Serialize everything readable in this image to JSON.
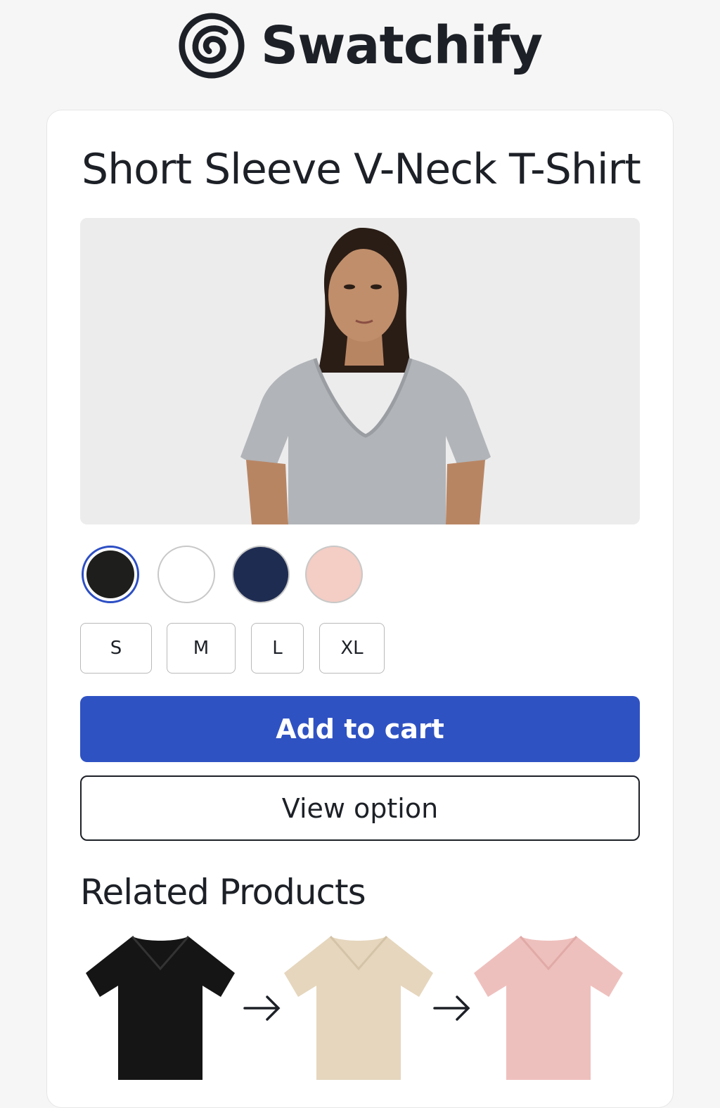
{
  "brand": {
    "name": "Swatchify",
    "logo_icon": "swirl-logo-icon"
  },
  "product": {
    "title": "Short Sleeve V-Neck T-Shirt",
    "image": "model-in-gray-vneck-tshirt",
    "colors": [
      {
        "name": "black",
        "hex": "#1e1f1c",
        "selected": true
      },
      {
        "name": "white",
        "hex": "#ffffff",
        "selected": false
      },
      {
        "name": "navy",
        "hex": "#1f2c52",
        "selected": false
      },
      {
        "name": "pink",
        "hex": "#f4cdc4",
        "selected": false
      }
    ],
    "sizes": [
      "S",
      "M",
      "L",
      "XL"
    ]
  },
  "actions": {
    "add_to_cart": "Add to cart",
    "view_option": "View option"
  },
  "related": {
    "title": "Related Products",
    "items": [
      {
        "name": "black-vneck-tshirt",
        "color": "#151515"
      },
      {
        "name": "beige-vneck-tshirt",
        "color": "#e5d6bd"
      },
      {
        "name": "pink-vneck-tshirt",
        "color": "#eec0bd"
      }
    ],
    "arrow_icon": "right-arrow-icon"
  },
  "colors": {
    "accent": "#2f52c3",
    "text": "#1d2127",
    "background": "#f6f6f6"
  }
}
